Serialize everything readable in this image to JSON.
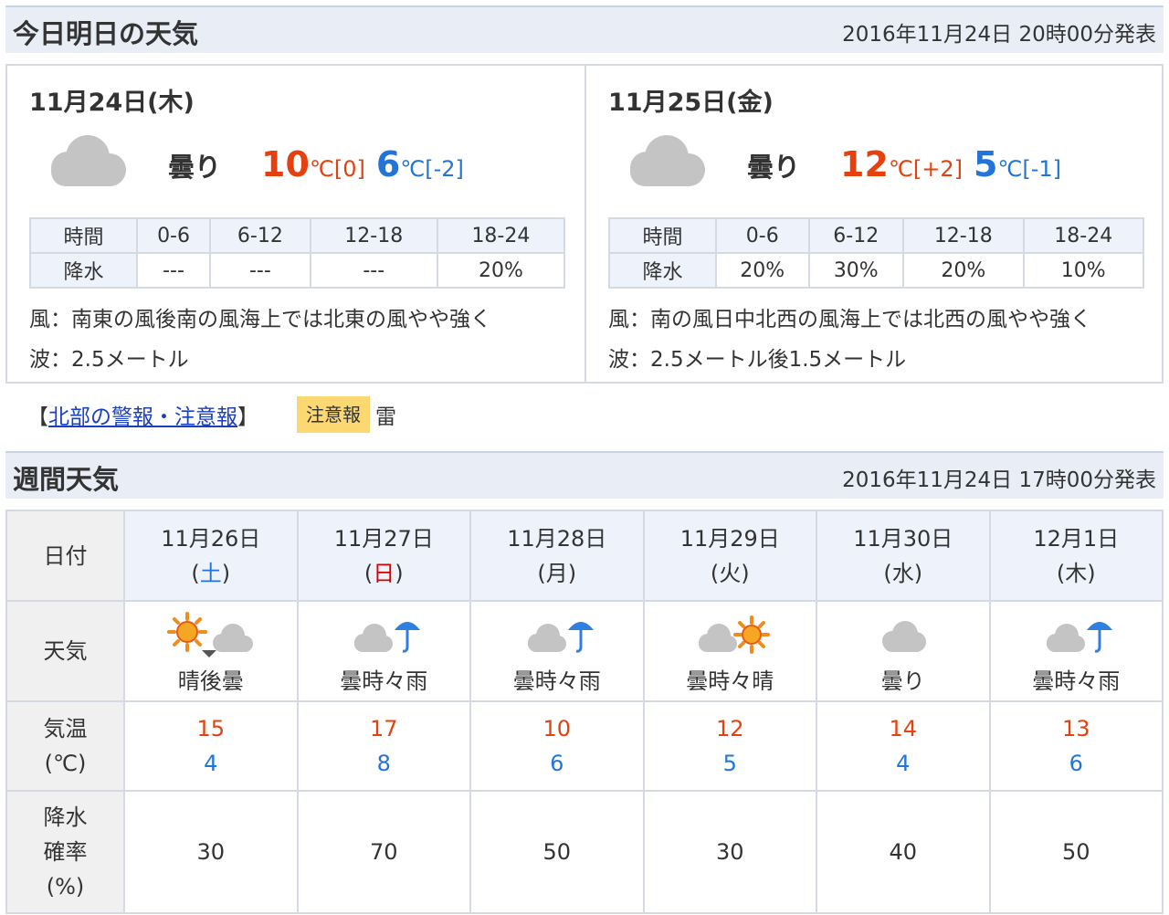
{
  "today_section": {
    "title": "今日明日の天気",
    "published": "2016年11月24日 20時00分発表",
    "days": [
      {
        "date": "11月24日(木)",
        "telop": "曇り",
        "icon": "cloud-icon",
        "high": "10",
        "high_unit": "℃[0]",
        "low": "6",
        "low_unit": "℃[-2]",
        "rain_table": {
          "header_label": "時間",
          "periods": [
            "0-6",
            "6-12",
            "12-18",
            "18-24"
          ],
          "row_label": "降水",
          "values": [
            "---",
            "---",
            "---",
            "20%"
          ]
        },
        "wind": "風：南東の風後南の風海上では北東の風やや強く",
        "wave": "波：2.5メートル"
      },
      {
        "date": "11月25日(金)",
        "telop": "曇り",
        "icon": "cloud-icon",
        "high": "12",
        "high_unit": "℃[+2]",
        "low": "5",
        "low_unit": "℃[-1]",
        "rain_table": {
          "header_label": "時間",
          "periods": [
            "0-6",
            "6-12",
            "12-18",
            "18-24"
          ],
          "row_label": "降水",
          "values": [
            "20%",
            "30%",
            "20%",
            "10%"
          ]
        },
        "wind": "風：南の風日中北西の風海上では北西の風やや強く",
        "wave": "波：2.5メートル後1.5メートル"
      }
    ]
  },
  "warning": {
    "bracket_open": "【",
    "link_text": "北部の警報・注意報",
    "bracket_close": "】",
    "badge": "注意報",
    "type": "雷"
  },
  "weekly_section": {
    "title": "週間天気",
    "published": "2016年11月24日 17時00分発表",
    "row_labels": {
      "date": "日付",
      "weather": "天気",
      "temp_line1": "気温",
      "temp_line2": "(℃)",
      "pop_line1": "降水",
      "pop_line2": "確率",
      "pop_line3": "(%)"
    },
    "days": [
      {
        "date": "11月26日",
        "dow_open": "(",
        "dow": "土",
        "dow_close": ")",
        "dow_style": "sat",
        "icon": "sun-then-cloud-icon",
        "telop": "晴後曇",
        "high": "15",
        "low": "4",
        "pop": "30"
      },
      {
        "date": "11月27日",
        "dow_open": "(",
        "dow": "日",
        "dow_close": ")",
        "dow_style": "sun",
        "icon": "cloud-sometimes-rain-icon",
        "telop": "曇時々雨",
        "high": "17",
        "low": "8",
        "pop": "70"
      },
      {
        "date": "11月28日",
        "dow_open": "(",
        "dow": "月",
        "dow_close": ")",
        "dow_style": "",
        "icon": "cloud-sometimes-rain-icon",
        "telop": "曇時々雨",
        "high": "10",
        "low": "6",
        "pop": "50"
      },
      {
        "date": "11月29日",
        "dow_open": "(",
        "dow": "火",
        "dow_close": ")",
        "dow_style": "",
        "icon": "cloud-sometimes-sun-icon",
        "telop": "曇時々晴",
        "high": "12",
        "low": "5",
        "pop": "30"
      },
      {
        "date": "11月30日",
        "dow_open": "(",
        "dow": "水",
        "dow_close": ")",
        "dow_style": "",
        "icon": "cloud-icon",
        "telop": "曇り",
        "high": "14",
        "low": "4",
        "pop": "40"
      },
      {
        "date": "12月1日",
        "dow_open": "(",
        "dow": "木",
        "dow_close": ")",
        "dow_style": "",
        "icon": "cloud-sometimes-rain-icon",
        "telop": "曇時々雨",
        "high": "13",
        "low": "6",
        "pop": "50"
      }
    ]
  },
  "colors": {
    "high_temp": "#e6400f",
    "low_temp": "#2274d8",
    "saturday": "#2274d8",
    "sunday": "#d40000",
    "header_bg": "#e8edf6",
    "badge_bg": "#fcd872",
    "link": "#1a3fbf"
  }
}
